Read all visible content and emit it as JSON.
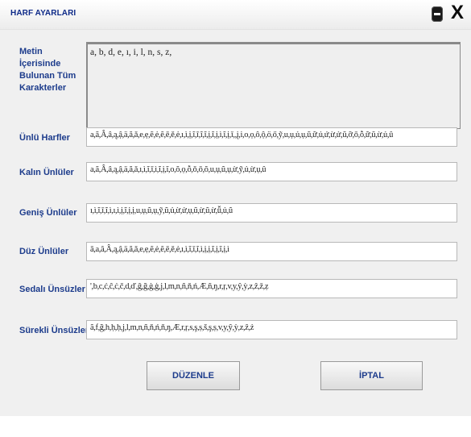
{
  "window": {
    "title": "HARF AYARLARI"
  },
  "fields": {
    "all_chars": {
      "label": "Metin İçerisinde Bulunan Tüm Karakterler",
      "value": "a, b, d, e, ı, i, l, n, s, z,"
    },
    "unlu": {
      "label": "Ünlü Harfler",
      "value": "a,ã,Â,â,ą,ậ,ä,ă,ǎ,e,ẹ,ẽ,ė,ẽ,ē,ě,ė,ı,ì,ị,ĩ,ī,ĩ,ĩ,ị,ĩ,ị,ì,ĩ,ị,ǐ,,į,i,o,ọ,ô,ộ,ö,ő,ỹ,u,ụ,ủ,ụ,ũ,ữ,ủ,ứ,ừ,ử,ũ,ỡ,ō,ỗ,ữ,ũ,ừ,ủ,û"
    },
    "kalin": {
      "label": "Kalın Ünlüler",
      "value": "a,ã,Â,â,ą,ậ,ä,ă,ǎ,ı,ì,ĩ,ī,ì,ĩ,ị,ĩ,o,ŏ,ọ,ỗ,ǒ,ō,ŏ,u,ụ,ũ,ụ,ừ,ỹ,ủ,ừ,ụ,û"
    },
    "genis": {
      "label": "Geniş Ünlüler",
      "value": "ı,ì,ĩ,ī,ĩ,ì,ı,ì,ị,ĩ,ị,ị,u,ụ,ũ,ụ,ỹ,ũ,ủ,ừ,ử,ụ,ũ,ừ,ũ,ừ,ǚ,ủ,ũ"
    },
    "duz": {
      "label": "Düz Ünlüler",
      "value": "ā,a,â,Â,ą,ậ,ä,ă,ǎ,e,ẹ,ẽ,ė,ẽ,ē,ě,ė,ı,ì,ĩ,ī,ĩ,ì,ị,ị,ĩ,ị,ĩ,ị,ì"
    },
    "sedali": {
      "label": "Sedalı Ünsüzler",
      "value": "',b,c,ć,ĉ,ċ,č,d,ď,ĝ,ğ,ġ,ģ,j,l,m,n,ñ,ň,ń,Æ,ñ,ŋ,r,ŗ,v,y,ŷ,ỳ,z,ẑ,ž,ẓ"
    },
    "surekli": {
      "label": "Sürekli Ünsüzler",
      "value": "ã,f,ğ,h,ḥ,ḥ,j,l,m,n,ñ,ň,ń,ň,ŋ,Æ,r,ŗ,s,ş,ṣ,š,ş,ṣ,v,y,ŷ,ỳ,z,ẑ,ż"
    }
  },
  "buttons": {
    "edit": "DÜZENLE",
    "cancel": "İPTAL"
  },
  "controls": {
    "close": "X"
  }
}
